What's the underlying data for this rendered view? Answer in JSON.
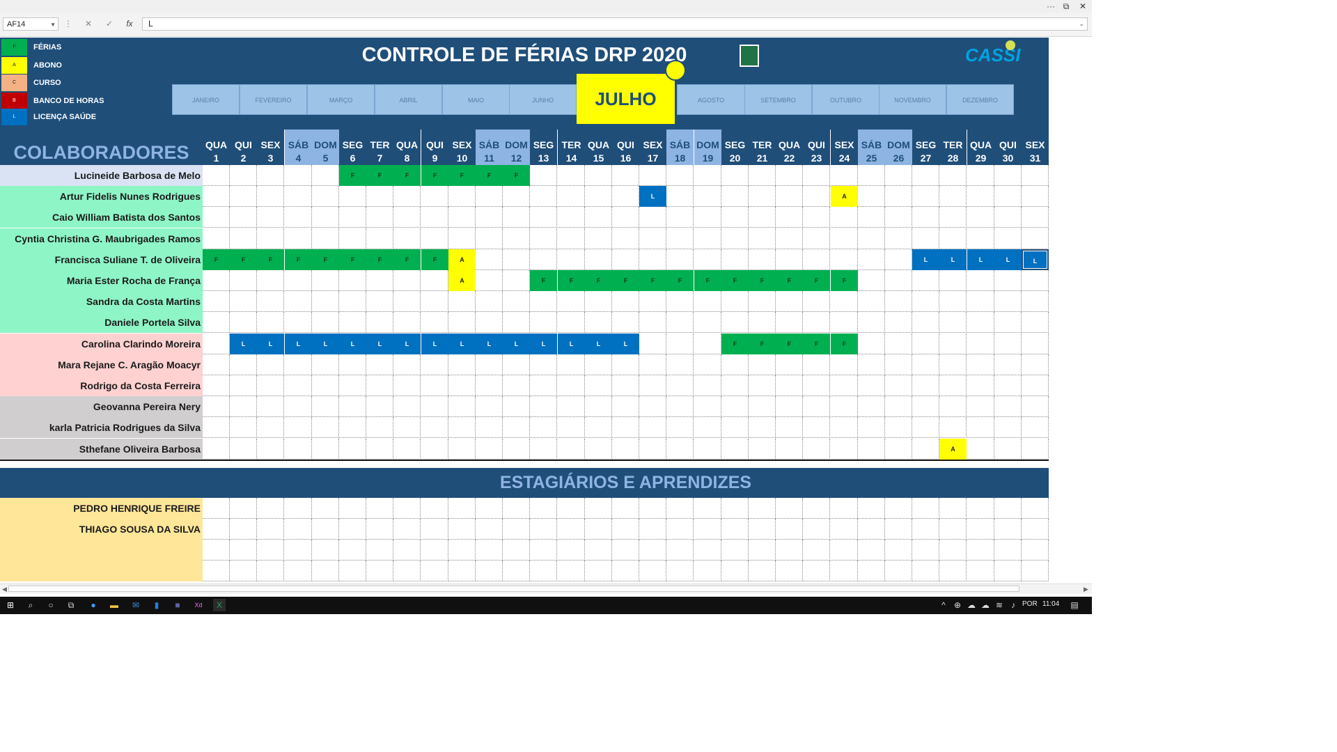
{
  "formula_bar": {
    "name_box": "AF14",
    "cancel": "✕",
    "enter": "✓",
    "fx": "fx",
    "content": "L"
  },
  "legend": [
    {
      "code": "F",
      "label": "FÉRIAS",
      "color": "#00b050"
    },
    {
      "code": "A",
      "label": "ABONO",
      "color": "#ffff00"
    },
    {
      "code": "C",
      "label": "CURSO",
      "color": "#f4b183"
    },
    {
      "code": "B",
      "label": "BANCO DE HORAS",
      "color": "#c00000"
    },
    {
      "code": "L",
      "label": "LICENÇA SAÚDE",
      "color": "#0070c0"
    }
  ],
  "header": {
    "title": "CONTROLE DE FÉRIAS DRP 2020",
    "logo": "CASSI",
    "active_month": "JULHO",
    "months": [
      "JANEIRO",
      "FEVEREIRO",
      "MARÇO",
      "ABRIL",
      "MAIO",
      "JUNHO",
      "JULHO",
      "AGOSTO",
      "SETEMBRO",
      "OUTUBRO",
      "NOVEMBRO",
      "DEZEMBRO"
    ]
  },
  "section_colab": "COLABORADORES",
  "section_estag": "ESTAGIÁRIOS E APRENDIZES",
  "days": [
    {
      "d": "QUA",
      "n": "1"
    },
    {
      "d": "QUI",
      "n": "2"
    },
    {
      "d": "SEX",
      "n": "3"
    },
    {
      "d": "SÁB",
      "n": "4"
    },
    {
      "d": "DOM",
      "n": "5"
    },
    {
      "d": "SEG",
      "n": "6"
    },
    {
      "d": "TER",
      "n": "7"
    },
    {
      "d": "QUA",
      "n": "8"
    },
    {
      "d": "QUI",
      "n": "9"
    },
    {
      "d": "SEX",
      "n": "10"
    },
    {
      "d": "SÁB",
      "n": "11"
    },
    {
      "d": "DOM",
      "n": "12"
    },
    {
      "d": "SEG",
      "n": "13"
    },
    {
      "d": "TER",
      "n": "14"
    },
    {
      "d": "QUA",
      "n": "15"
    },
    {
      "d": "QUI",
      "n": "16"
    },
    {
      "d": "SEX",
      "n": "17"
    },
    {
      "d": "SÁB",
      "n": "18"
    },
    {
      "d": "DOM",
      "n": "19"
    },
    {
      "d": "SEG",
      "n": "20"
    },
    {
      "d": "TER",
      "n": "21"
    },
    {
      "d": "QUA",
      "n": "22"
    },
    {
      "d": "QUI",
      "n": "23"
    },
    {
      "d": "SEX",
      "n": "24"
    },
    {
      "d": "SÁB",
      "n": "25"
    },
    {
      "d": "DOM",
      "n": "26"
    },
    {
      "d": "SEG",
      "n": "27"
    },
    {
      "d": "TER",
      "n": "28"
    },
    {
      "d": "QUA",
      "n": "29"
    },
    {
      "d": "QUI",
      "n": "30"
    },
    {
      "d": "SEX",
      "n": "31"
    }
  ],
  "employees": [
    {
      "name": "Lucineide Barbosa de Melo",
      "group_color": "#dae3f3",
      "marks": {
        "6": "F",
        "7": "F",
        "8": "F",
        "9": "F",
        "10": "F",
        "11": "F",
        "12": "F"
      }
    },
    {
      "name": "Artur Fidelis Nunes Rodrigues",
      "group_color": "#8ef5c6",
      "marks": {
        "17": "L",
        "24": "A"
      }
    },
    {
      "name": "Caio William Batista dos Santos",
      "group_color": "#8ef5c6",
      "marks": {}
    },
    {
      "name": "Cyntia Christina G. Maubrigades Ramos",
      "group_color": "#8ef5c6",
      "marks": {}
    },
    {
      "name": "Francisca Suliane T. de Oliveira",
      "group_color": "#8ef5c6",
      "marks": {
        "1": "F",
        "2": "F",
        "3": "F",
        "4": "F",
        "5": "F",
        "6": "F",
        "7": "F",
        "8": "F",
        "9": "F",
        "10": "A",
        "27": "L",
        "28": "L",
        "29": "L",
        "30": "L",
        "31": "L"
      }
    },
    {
      "name": "Maria Ester Rocha de França",
      "group_color": "#8ef5c6",
      "marks": {
        "10": "A",
        "13": "F",
        "14": "F",
        "15": "F",
        "16": "F",
        "17": "F",
        "18": "F",
        "19": "F",
        "20": "F",
        "21": "F",
        "22": "F",
        "23": "F",
        "24": "F"
      }
    },
    {
      "name": "Sandra da Costa Martins",
      "group_color": "#8ef5c6",
      "marks": {}
    },
    {
      "name": "Daniele Portela Silva",
      "group_color": "#8ef5c6",
      "marks": {}
    },
    {
      "name": "Carolina Clarindo Moreira",
      "group_color": "#ffd1d1",
      "marks": {
        "2": "L",
        "3": "L",
        "4": "L",
        "5": "L",
        "6": "L",
        "7": "L",
        "8": "L",
        "9": "L",
        "10": "L",
        "11": "L",
        "12": "L",
        "13": "L",
        "14": "L",
        "15": "L",
        "16": "L",
        "20": "F",
        "21": "F",
        "22": "F",
        "23": "F",
        "24": "F"
      }
    },
    {
      "name": "Mara Rejane C. Aragão Moacyr",
      "group_color": "#ffd1d1",
      "marks": {}
    },
    {
      "name": "Rodrigo da Costa Ferreira",
      "group_color": "#ffd1d1",
      "marks": {}
    },
    {
      "name": "Geovanna Pereira Nery",
      "group_color": "#d0cece",
      "marks": {}
    },
    {
      "name": "karla Patricia Rodrigues da Silva",
      "group_color": "#d0cece",
      "marks": {}
    },
    {
      "name": "Sthefane Oliveira Barbosa",
      "group_color": "#d0cece",
      "marks": {
        "28": "A"
      }
    }
  ],
  "interns": [
    {
      "name": "PEDRO HENRIQUE FREIRE"
    },
    {
      "name": "THIAGO SOUSA DA SILVA"
    },
    {
      "name": ""
    },
    {
      "name": ""
    }
  ],
  "selected_cell": {
    "row": "Francisca Suliane T. de Oliveira",
    "day": "31"
  },
  "taskbar": {
    "language": "POR",
    "time": "11:04"
  }
}
